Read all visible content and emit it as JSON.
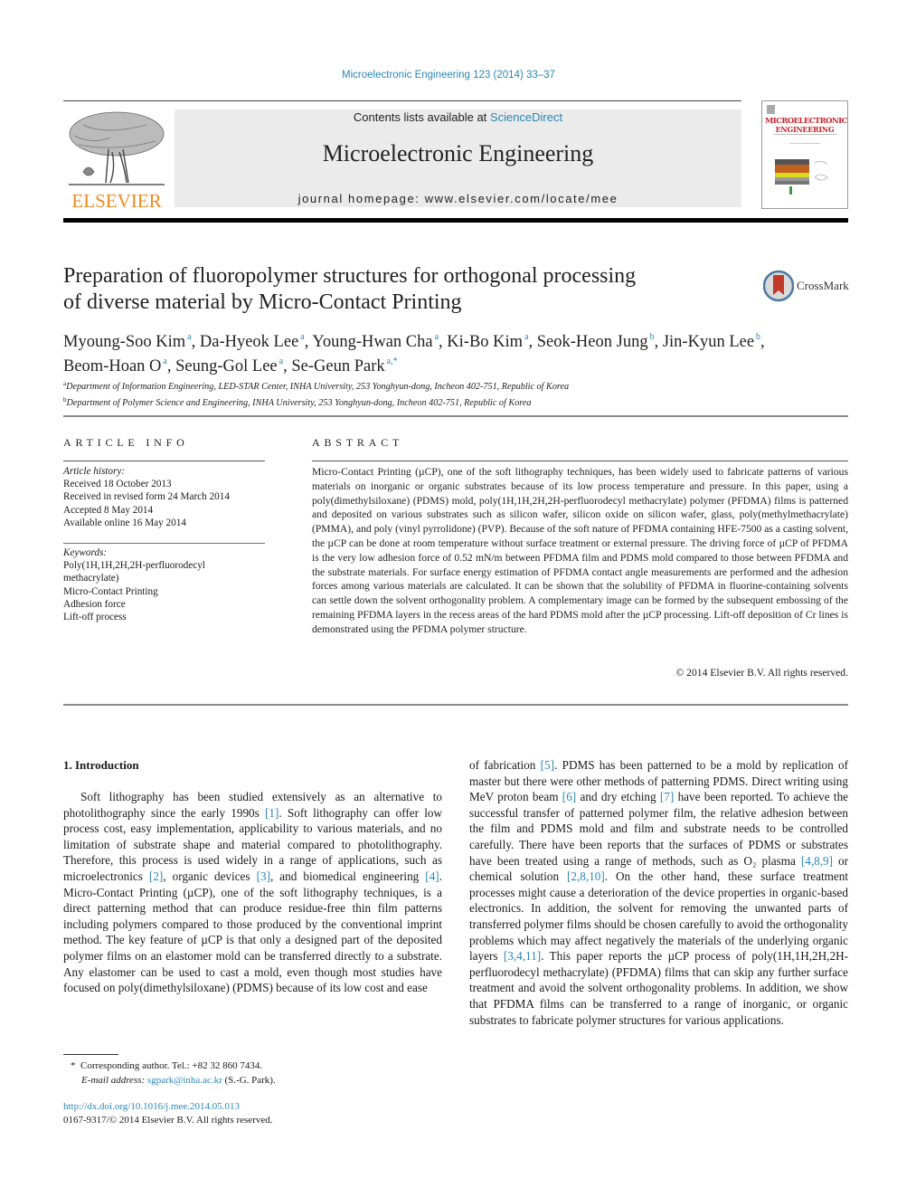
{
  "header": {
    "journal_ref": "Microelectronic Engineering 123 (2014) 33–37",
    "contents_prefix": "Contents lists available at ",
    "contents_link": "ScienceDirect",
    "journal_name": "Microelectronic Engineering",
    "homepage": "journal homepage: www.elsevier.com/locate/mee",
    "publisher_logo_text": "ELSEVIER",
    "cover_title_line1": "MICROELECTRONIC",
    "cover_title_line2": "ENGINEERING",
    "brand_orange": "#f08a1c",
    "link_color": "#2a87b8"
  },
  "article": {
    "title_line1": "Preparation of fluoropolymer structures for orthogonal processing",
    "title_line2": "of diverse material by Micro-Contact Printing",
    "crossmark_label": "CrossMark",
    "authors": [
      {
        "name": "Myoung-Soo Kim",
        "aff": "a"
      },
      {
        "name": "Da-Hyeok Lee",
        "aff": "a"
      },
      {
        "name": "Young-Hwan Cha",
        "aff": "a"
      },
      {
        "name": "Ki-Bo Kim",
        "aff": "a"
      },
      {
        "name": "Seok-Heon Jung",
        "aff": "b"
      },
      {
        "name": "Jin-Kyun Lee",
        "aff": "b"
      },
      {
        "name": "Beom-Hoan O",
        "aff": "a"
      },
      {
        "name": "Seung-Gol Lee",
        "aff": "a"
      },
      {
        "name": "Se-Geun Park",
        "aff": "a,*"
      }
    ],
    "affiliations": [
      {
        "key": "a",
        "text": "Department of Information Engineering, LED-STAR Center, INHA University, 253 Yonghyun-dong, Incheon 402-751, Republic of Korea"
      },
      {
        "key": "b",
        "text": "Department of Polymer Science and Engineering, INHA University, 253 Yonghyun-dong, Incheon 402-751, Republic of Korea"
      }
    ]
  },
  "article_info": {
    "heading": "ARTICLE INFO",
    "history_label": "Article history:",
    "history": [
      "Received 18 October 2013",
      "Received in revised form 24 March 2014",
      "Accepted 8 May 2014",
      "Available online 16 May 2014"
    ],
    "keywords_label": "Keywords:",
    "keywords": [
      "Poly(1H,1H,2H,2H-perfluorodecyl",
      "methacrylate)",
      "Micro-Contact Printing",
      "Adhesion force",
      "Lift-off process"
    ]
  },
  "abstract": {
    "heading": "ABSTRACT",
    "text": "Micro-Contact Printing (µCP), one of the soft lithography techniques, has been widely used to fabricate patterns of various materials on inorganic or organic substrates because of its low process temperature and pressure. In this paper, using a poly(dimethylsiloxane) (PDMS) mold, poly(1H,1H,2H,2H-perfluorodecyl methacrylate) polymer (PFDMA) films is patterned and deposited on various substrates such as silicon wafer, silicon oxide on silicon wafer, glass, poly(methylmethacrylate) (PMMA), and poly (vinyl pyrrolidone) (PVP). Because of the soft nature of PFDMA containing HFE-7500 as a casting solvent, the µCP can be done at room temperature without surface treatment or external pressure. The driving force of µCP of PFDMA is the very low adhesion force of 0.52 mN/m between PFDMA film and PDMS mold compared to those between PFDMA and the substrate materials. For surface energy estimation of PFDMA contact angle measurements are performed and the adhesion forces among various materials are calculated. It can be shown that the solubility of PFDMA in fluorine-containing solvents can settle down the solvent orthogonality problem. A complementary image can be formed by the subsequent embossing of the remaining PFDMA layers in the recess areas of the hard PDMS mold after the µCP processing. Lift-off deposition of Cr lines is demonstrated using the PFDMA polymer structure.",
    "copyright": "© 2014 Elsevier B.V. All rights reserved."
  },
  "body": {
    "section_heading": "1. Introduction",
    "left_segments": [
      {
        "t": "Soft lithography has been studied extensively as an alternative to photolithography since the early 1990s "
      },
      {
        "ref": "[1]"
      },
      {
        "t": ". Soft lithography can offer low process cost, easy implementation, applicability to various materials, and no limitation of substrate shape and material compared to photolithography. Therefore, this process is used widely in a range of applications, such as microelectronics "
      },
      {
        "ref": "[2]"
      },
      {
        "t": ", organic devices "
      },
      {
        "ref": "[3]"
      },
      {
        "t": ", and biomedical engineering "
      },
      {
        "ref": "[4]"
      },
      {
        "t": ". Micro-Contact Printing (µCP), one of the soft lithography techniques, is a direct patterning method that can produce residue-free thin film patterns including polymers compared to those produced by the conventional imprint method. The key feature of µCP is that only a designed part of the deposited polymer films on an elastomer mold can be transferred directly to a substrate. Any elastomer can be used to cast a mold, even though most studies have focused on poly(dimethylsiloxane) (PDMS) because of its low cost and ease"
      }
    ],
    "right_segments": [
      {
        "t": "of fabrication "
      },
      {
        "ref": "[5]"
      },
      {
        "t": ". PDMS has been patterned to be a mold by replication of master but there were other methods of patterning PDMS. Direct writing using MeV proton beam "
      },
      {
        "ref": "[6]"
      },
      {
        "t": " and dry etching "
      },
      {
        "ref": "[7]"
      },
      {
        "t": " have been reported. To achieve the successful transfer of patterned polymer film, the relative adhesion between the film and PDMS mold and film and substrate needs to be controlled carefully. There have been reports that the surfaces of PDMS or substrates have been treated using a range of methods, such as O₂ plasma "
      },
      {
        "ref": "[4,8,9]"
      },
      {
        "t": " or chemical solution "
      },
      {
        "ref": "[2,8,10]"
      },
      {
        "t": ". On the other hand, these surface treatment processes might cause a deterioration of the device properties in organic-based electronics. In addition, the solvent for removing the unwanted parts of transferred polymer films should be chosen carefully to avoid the orthogonality problems which may affect negatively the materials of the underlying organic layers "
      },
      {
        "ref": "[3,4,11]"
      },
      {
        "t": ". This paper reports the µCP process of poly(1H,1H,2H,2H-perfluorodecyl methacrylate) (PFDMA) films that can skip any further surface treatment and avoid the solvent orthogonality problems. In addition, we show that PFDMA films can be transferred to a range of inorganic, or organic substrates to fabricate polymer structures for various applications."
      }
    ]
  },
  "footnotes": {
    "star": "*",
    "corresponding": "Corresponding author. Tel.: +82 32 860 7434.",
    "email_label": "E-mail address: ",
    "email": "sgpark@inha.ac.kr",
    "email_suffix": " (S.-G. Park).",
    "doi": "http://dx.doi.org/10.1016/j.mee.2014.05.013",
    "issn_line": "0167-9317/© 2014 Elsevier B.V. All rights reserved."
  }
}
